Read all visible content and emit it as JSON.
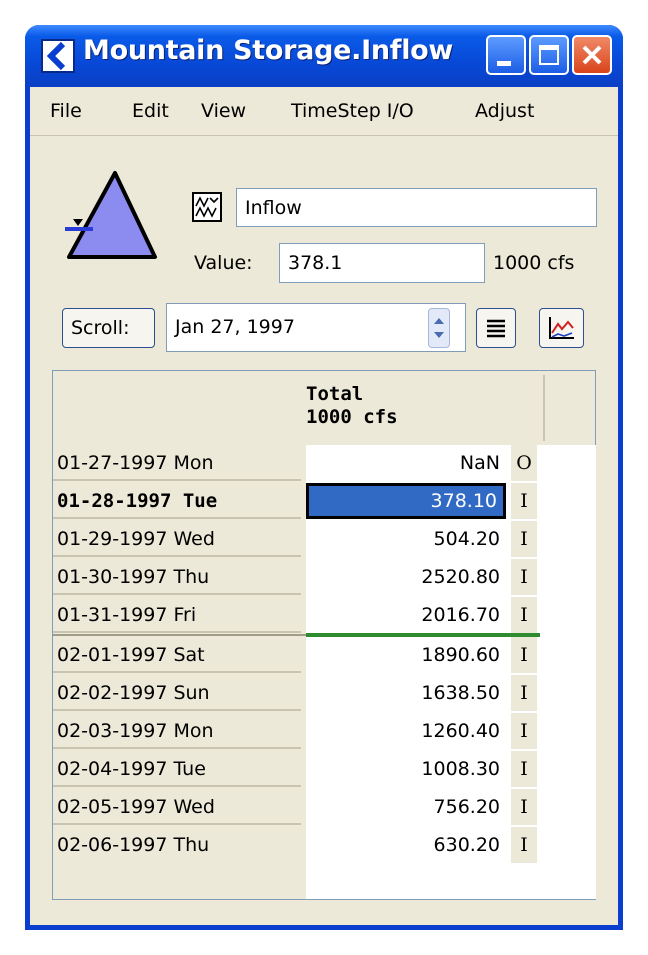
{
  "window": {
    "title": "Mountain Storage.Inflow",
    "accent": "#0a3ecf"
  },
  "menu": [
    "File",
    "Edit",
    "View",
    "TimeStep I/O",
    "Adjust"
  ],
  "slot": {
    "name": "Inflow",
    "value_label": "Value:",
    "value": "378.1",
    "units": "1000 cfs"
  },
  "toolbar": {
    "scroll_label": "Scroll:",
    "date": "Jan 27, 1997"
  },
  "table": {
    "header_line1": "Total",
    "header_line2": "1000 cfs",
    "rows": [
      {
        "date": "01-27-1997 Mon",
        "value": "NaN",
        "flag": "O"
      },
      {
        "date": "01-28-1997 Tue",
        "value": "378.10",
        "flag": "I",
        "selected": true
      },
      {
        "date": "01-29-1997 Wed",
        "value": "504.20",
        "flag": "I"
      },
      {
        "date": "01-30-1997 Thu",
        "value": "2520.80",
        "flag": "I"
      },
      {
        "date": "01-31-1997 Fri",
        "value": "2016.70",
        "flag": "I"
      },
      {
        "date": "02-01-1997 Sat",
        "value": "1890.60",
        "flag": "I"
      },
      {
        "date": "02-02-1997 Sun",
        "value": "1638.50",
        "flag": "I"
      },
      {
        "date": "02-03-1997 Mon",
        "value": "1260.40",
        "flag": "I"
      },
      {
        "date": "02-04-1997 Tue",
        "value": "1008.30",
        "flag": "I"
      },
      {
        "date": "02-05-1997 Wed",
        "value": "756.20",
        "flag": "I"
      },
      {
        "date": "02-06-1997 Thu",
        "value": "630.20",
        "flag": "I"
      }
    ]
  },
  "colors": {
    "selection": "#316ac5",
    "month_divider": "#2e8b2e",
    "reservoir": "#8c8cf0"
  }
}
